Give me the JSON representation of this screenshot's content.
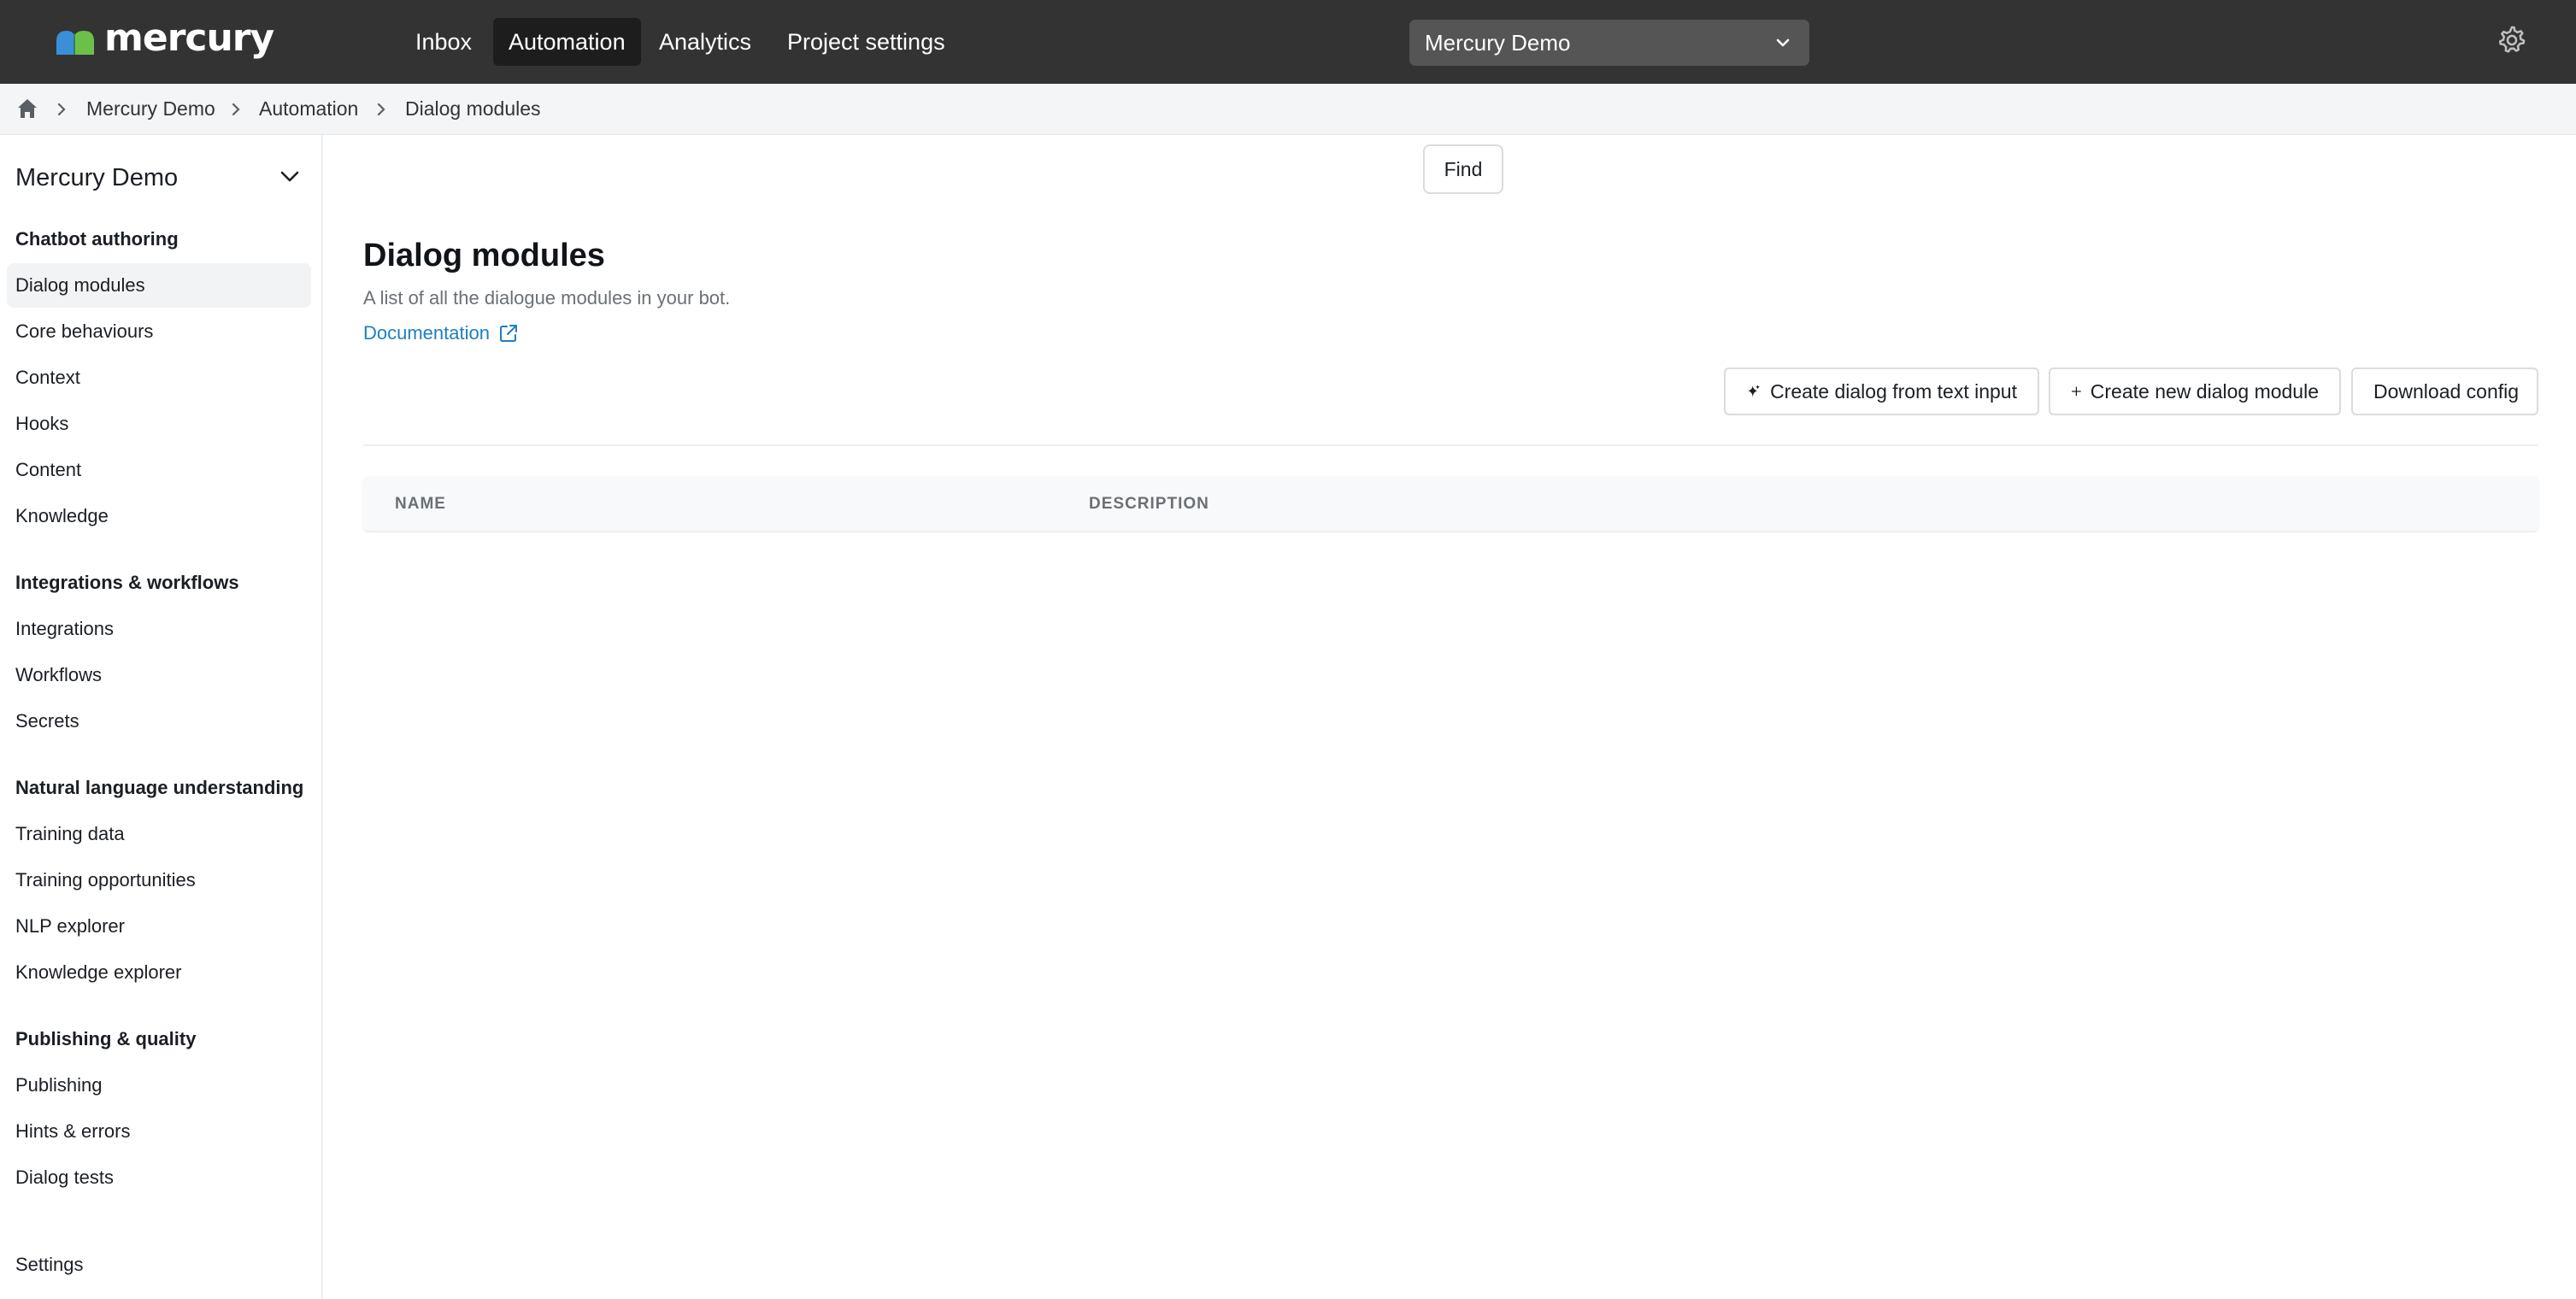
{
  "app": {
    "logo_text": "mercury"
  },
  "nav": {
    "items": [
      {
        "label": "Inbox",
        "active": false
      },
      {
        "label": "Automation",
        "active": true
      },
      {
        "label": "Analytics",
        "active": false
      },
      {
        "label": "Project settings",
        "active": false
      }
    ],
    "project_select": "Mercury Demo",
    "settings_icon": "gear-icon"
  },
  "breadcrumb": {
    "home_icon": "home-icon",
    "items": [
      "Mercury Demo",
      "Automation",
      "Dialog modules"
    ]
  },
  "sidebar": {
    "project": "Mercury Demo",
    "sections": [
      {
        "heading": "Chatbot authoring",
        "items": [
          "Dialog modules",
          "Core behaviours",
          "Context",
          "Hooks",
          "Content",
          "Knowledge"
        ]
      },
      {
        "heading": "Integrations & workflows",
        "items": [
          "Integrations",
          "Workflows",
          "Secrets"
        ]
      },
      {
        "heading": "Natural language understanding",
        "items": [
          "Training data",
          "Training opportunities",
          "NLP explorer",
          "Knowledge explorer"
        ]
      },
      {
        "heading": "Publishing & quality",
        "items": [
          "Publishing",
          "Hints & errors",
          "Dialog tests"
        ]
      }
    ],
    "active_item": "Dialog modules",
    "footer_item": "Settings"
  },
  "main": {
    "find_label": "Find",
    "title": "Dialog modules",
    "subtitle": "A list of all the dialogue modules in your bot.",
    "doc_link": "Documentation",
    "buttons": {
      "create_from_text": "Create dialog from text input",
      "create_new": "Create new dialog module",
      "download": "Download config"
    },
    "table": {
      "columns": [
        "NAME",
        "DESCRIPTION"
      ],
      "rows": []
    }
  },
  "colors": {
    "topbar": "#333333",
    "link": "#1c7fc2",
    "logo_blue": "#3b8fd9",
    "logo_green": "#6cc04a"
  }
}
